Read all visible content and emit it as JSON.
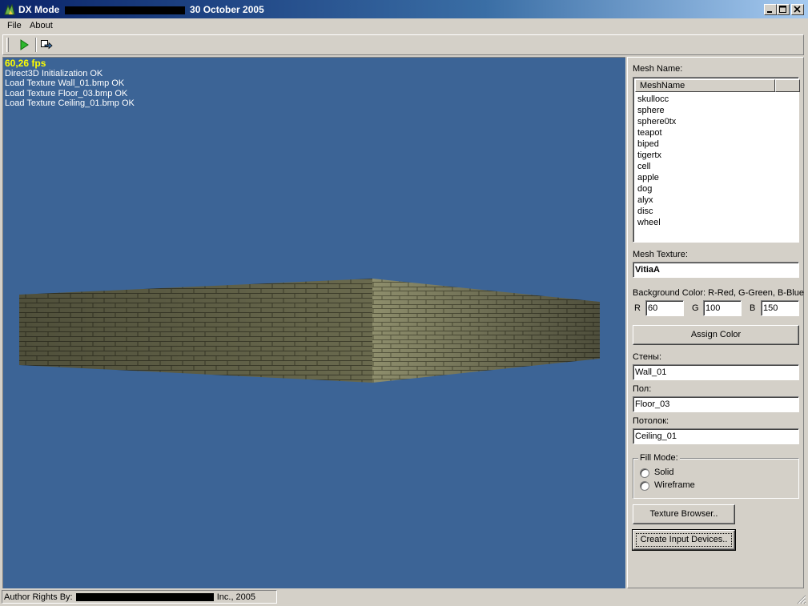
{
  "window": {
    "title_prefix": "DX Mode",
    "title_suffix": "30 October 2005"
  },
  "menu": [
    {
      "label": "File"
    },
    {
      "label": "About"
    }
  ],
  "toolbar": {
    "buttons": [
      {
        "icon": "play-icon"
      },
      {
        "icon": "export-icon"
      }
    ]
  },
  "viewport": {
    "fps": "60,26 fps",
    "log": [
      "Direct3D Initialization OK",
      "Load Texture Wall_01.bmp OK",
      "Load Texture Floor_03.bmp OK",
      "Load Texture Ceiling_01.bmp OK"
    ],
    "background_color": "#3c6496"
  },
  "panel": {
    "mesh_name_label": "Mesh Name:",
    "mesh_list_header": "MeshName",
    "mesh_list": [
      "skullocc",
      "sphere",
      "sphere0tx",
      "teapot",
      "biped",
      "tigertx",
      "cell",
      "apple",
      "dog",
      "alyx",
      "disc",
      "wheel"
    ],
    "mesh_texture_label": "Mesh Texture:",
    "mesh_texture_value": "VitiaA",
    "bg_color_label": "Background Color: R-Red, G-Green, B-Blue",
    "r_label": "R",
    "r_value": "60",
    "g_label": "G",
    "g_value": "100",
    "b_label": "B",
    "b_value": "150",
    "assign_color_button": "Assign Color",
    "walls_label": "Стены:",
    "walls_value": "Wall_01",
    "floor_label": "Пол:",
    "floor_value": "Floor_03",
    "ceiling_label": "Потолок:",
    "ceiling_value": "Ceiling_01",
    "fill_mode_label": "Fill Mode:",
    "fill_solid": "Solid",
    "fill_wireframe": "Wireframe",
    "texture_browser_button": "Texture Browser..",
    "create_input_button": "Create Input Devices.."
  },
  "statusbar": {
    "author_prefix": "Author Rights By:",
    "author_suffix": "Inc., 2005"
  }
}
